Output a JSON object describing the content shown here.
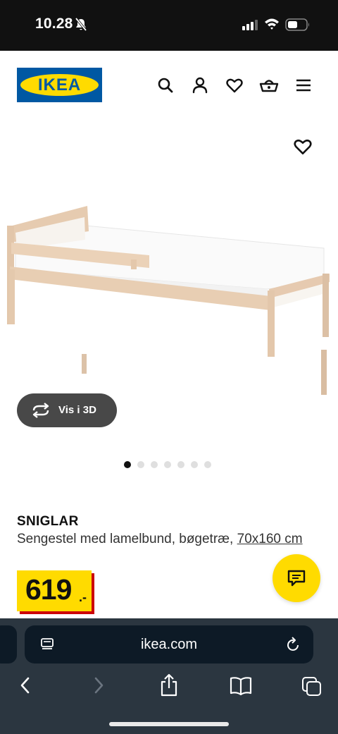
{
  "status_bar": {
    "time": "10.28",
    "icons": [
      "bell-slash-icon",
      "signal-icon",
      "wifi-icon",
      "battery-icon"
    ]
  },
  "header": {
    "logo_text": "IKEA",
    "icons": [
      "search-icon",
      "account-icon",
      "heart-icon",
      "basket-icon",
      "menu-icon"
    ]
  },
  "gallery": {
    "view_3d_label": "Vis i 3D",
    "slide_count": 7,
    "active_slide": 1
  },
  "product": {
    "name": "SNIGLAR",
    "description": "Sengestel med lamelbund, bøgetræ, ",
    "size": "70x160 cm",
    "price_main": "619",
    "price_suffix": ".-"
  },
  "browser": {
    "url": "ikea.com",
    "icons": [
      "reader-icon",
      "reload-icon",
      "back-icon",
      "forward-icon",
      "share-icon",
      "bookmarks-icon",
      "tabs-icon"
    ]
  },
  "colors": {
    "ikea_blue": "#0058A3",
    "ikea_yellow": "#FFDB00",
    "price_red": "#CC0008",
    "status_bar": "#111111",
    "browser_bar": "#2b3640"
  }
}
